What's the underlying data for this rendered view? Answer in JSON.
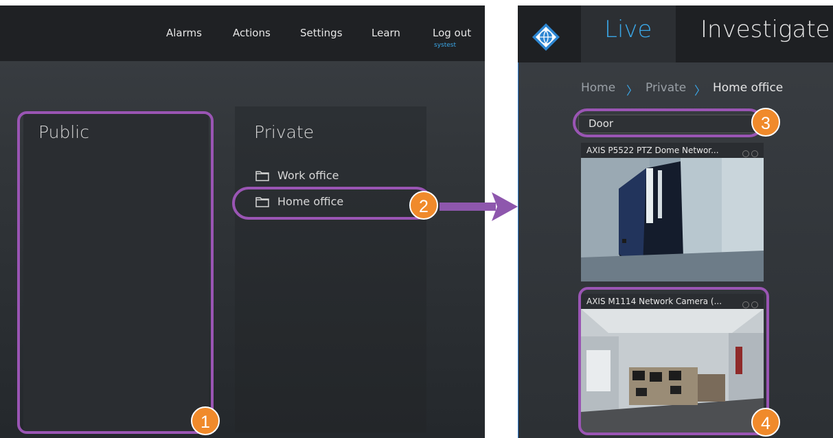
{
  "left": {
    "nav": {
      "alarms": "Alarms",
      "actions": "Actions",
      "settings": "Settings",
      "learn": "Learn",
      "logout": "Log out",
      "username": "systest"
    },
    "public_title": "Public",
    "private_title": "Private",
    "folders": [
      "Work office",
      "Home office"
    ]
  },
  "right": {
    "tabs": {
      "live": "Live",
      "investigate": "Investigate"
    },
    "breadcrumb": [
      "Home",
      "Private",
      "Home office"
    ],
    "breadcrumb_separator": "〉",
    "search_value": "Door",
    "cameras": [
      {
        "title": "AXIS P5522 PTZ Dome Networ..."
      },
      {
        "title": "AXIS M1114 Network Camera (..."
      }
    ]
  },
  "callouts": [
    "1",
    "2",
    "3",
    "4"
  ],
  "colors": {
    "accent": "#3aa6e6",
    "highlight": "#9a55b4",
    "badge": "#f08a2b"
  }
}
